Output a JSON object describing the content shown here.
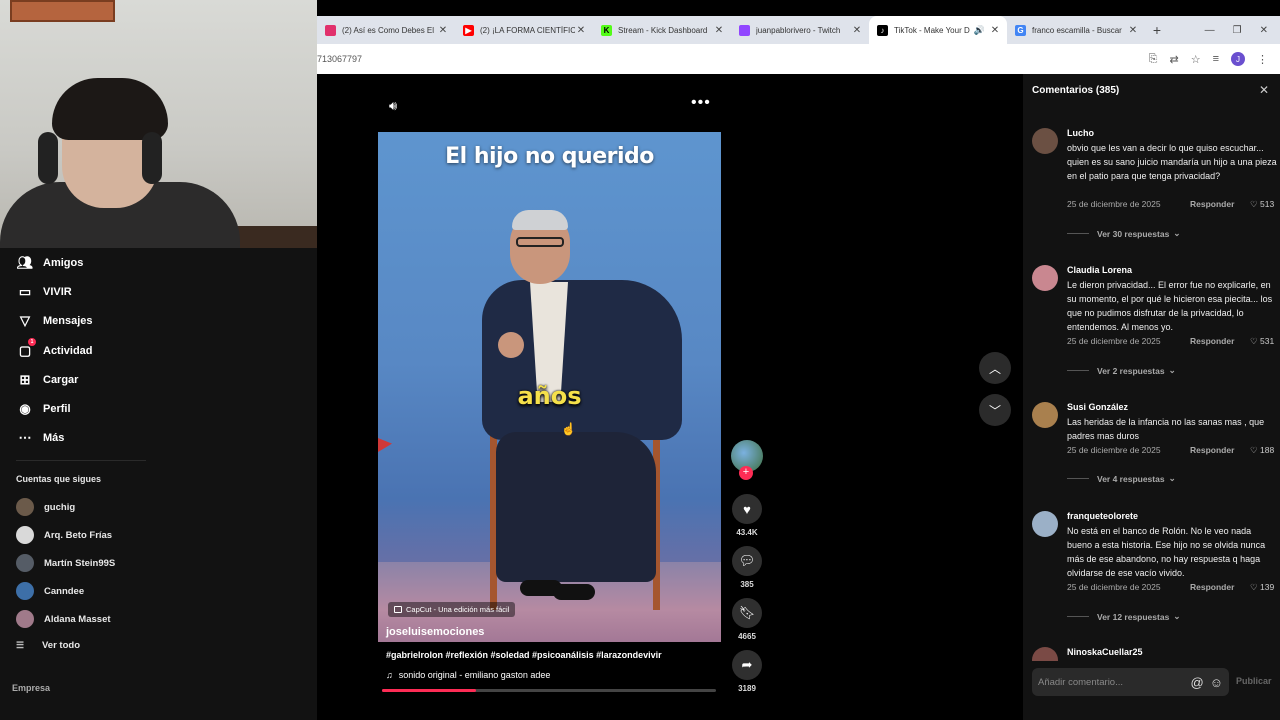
{
  "browser": {
    "tabs": [
      {
        "title": "(2) Así es Como Debes El",
        "color": "#e1306c",
        "icon": "instagram-icon"
      },
      {
        "title": "(2) ¡LA FORMA CIENTÍFIC",
        "color": "#ff0000",
        "icon": "youtube-icon"
      },
      {
        "title": "Stream - Kick Dashboard",
        "color": "#53fc18",
        "icon": "kick-icon"
      },
      {
        "title": "juanpablorivero - Twitch",
        "color": "#9146ff",
        "icon": "twitch-icon"
      },
      {
        "title": "TikTok - Make Your D",
        "color": "#000000",
        "icon": "tiktok-icon",
        "active": true
      },
      {
        "title": "franco escamilla - Buscar",
        "color": "#4285f4",
        "icon": "google-icon"
      }
    ],
    "url": "713067797",
    "profile_initial": "J"
  },
  "sidebar": {
    "nav": [
      {
        "label": "Amigos",
        "icon": "friends-icon"
      },
      {
        "label": "VIVIR",
        "icon": "live-icon"
      },
      {
        "label": "Mensajes",
        "icon": "messages-icon"
      },
      {
        "label": "Actividad",
        "icon": "activity-icon",
        "badge": "1"
      },
      {
        "label": "Cargar",
        "icon": "upload-icon"
      },
      {
        "label": "Perfil",
        "icon": "profile-icon"
      },
      {
        "label": "Más",
        "icon": "more-icon"
      }
    ],
    "following_title": "Cuentas que sigues",
    "following": [
      {
        "name": "guchig",
        "color": "#6b5a4a"
      },
      {
        "name": "Arq. Beto Frías",
        "color": "#d9d9d9"
      },
      {
        "name": "Martín Stein99S",
        "color": "#555c66"
      },
      {
        "name": "Canndee",
        "color": "#3d6fa8"
      },
      {
        "name": "Aldana Masset",
        "color": "#a07a8a"
      }
    ],
    "see_all": "Ver todo",
    "empresa": "Empresa"
  },
  "video": {
    "title_overlay": "El hijo no querido",
    "caption_overlay": "años",
    "capcut": "CapCut - Una edición más fácil",
    "author": "joseluisemociones",
    "hashtags": "#gabrielrolon #reflexión #soledad #psicoanálisis #larazondevivir",
    "sound": "sonido original - emiliano gaston adee",
    "progress": 0.28,
    "likes": "43.4K",
    "comments": "385",
    "saves": "4665",
    "shares": "3189"
  },
  "comments": {
    "header": "Comentarios (385)",
    "items": [
      {
        "user": "Lucho",
        "avatar": "#6b5043",
        "text": "obvio que les van a decir lo que quiso escuchar... quien es su sano juicio mandaría un hijo a una pieza en el patio para que tenga privacidad?",
        "date": "25 de diciembre de 2025",
        "reply": "Responder",
        "likes": "513",
        "more": "Ver 30 respuestas"
      },
      {
        "user": "Claudia Lorena",
        "avatar": "#c98790",
        "text": "Le dieron privacidad... El error fue no explicarle, en su momento, el por qué le hicieron esa piecita... los que no pudimos disfrutar de la privacidad, lo entendemos. Al menos yo.",
        "date": "25 de diciembre de 2025",
        "reply": "Responder",
        "likes": "531",
        "more": "Ver 2 respuestas"
      },
      {
        "user": "Susi González",
        "avatar": "#a9804e",
        "text": "Las heridas de la infancia no las sanas mas , que padres mas duros",
        "date": "25 de diciembre de 2025",
        "reply": "Responder",
        "likes": "188",
        "more": "Ver 4 respuestas"
      },
      {
        "user": "franqueteolorete",
        "avatar": "#9bb0c7",
        "text": "No está en el banco de Rolón. No le veo nada bueno a esta historia. Ese hijo no se olvida nunca más de ese abandono, no hay respuesta q haga olvidarse de ese vacío vivido.",
        "date": "25 de diciembre de 2025",
        "reply": "Responder",
        "likes": "139",
        "more": "Ver 12 respuestas"
      },
      {
        "user": "NinoskaCuellar25",
        "avatar": "#7a4a45"
      }
    ],
    "input_placeholder": "Añadir comentario...",
    "publish": "Publicar"
  }
}
